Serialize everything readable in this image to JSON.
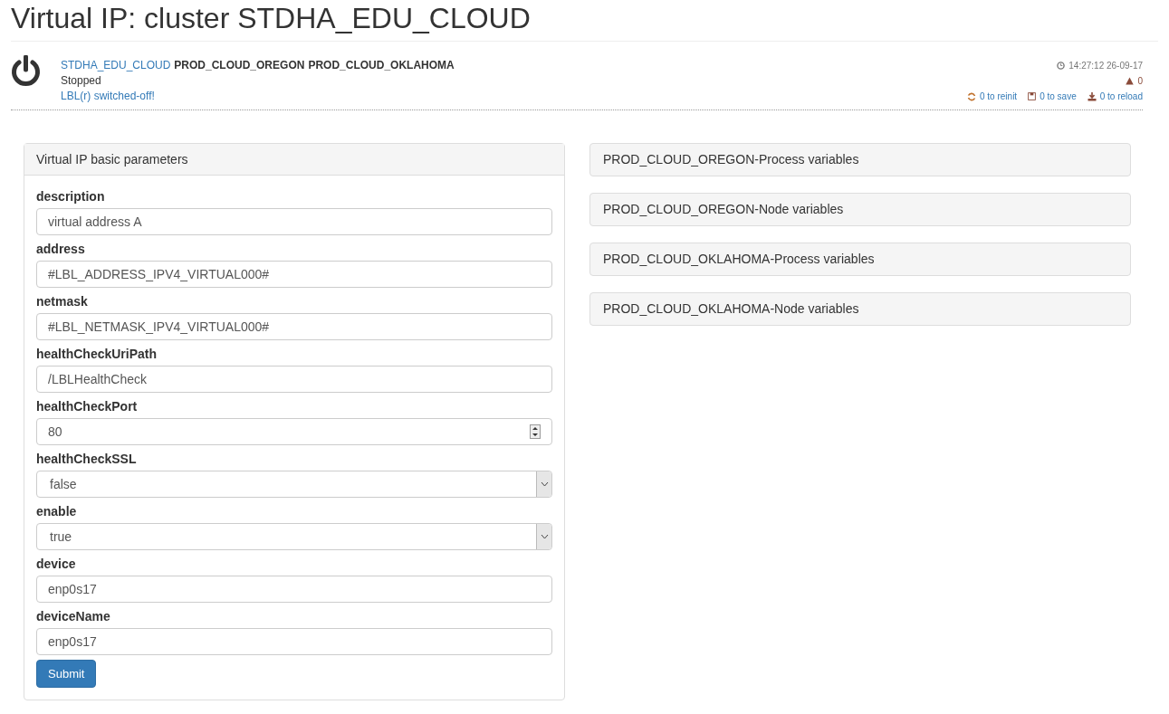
{
  "title": "Virtual IP: cluster STDHA_EDU_CLOUD",
  "status": {
    "cluster": "STDHA_EDU_CLOUD",
    "nodes": [
      "PROD_CLOUD_OREGON",
      "PROD_CLOUD_OKLAHOMA"
    ],
    "state": "Stopped",
    "message": "LBL(r) switched-off!",
    "time": "14:27:12 26-09-17",
    "warnings": "0",
    "reinit": "0 to reinit",
    "save": "0 to save",
    "reload": "0 to reload"
  },
  "form": {
    "heading": "Virtual IP basic parameters",
    "submit": "Submit",
    "fields": [
      {
        "label": "description",
        "kind": "text",
        "value": "virtual address A"
      },
      {
        "label": "address",
        "kind": "text",
        "value": "#LBL_ADDRESS_IPV4_VIRTUAL000#"
      },
      {
        "label": "netmask",
        "kind": "text",
        "value": "#LBL_NETMASK_IPV4_VIRTUAL000#"
      },
      {
        "label": "healthCheckUriPath",
        "kind": "text",
        "value": "/LBLHealthCheck"
      },
      {
        "label": "healthCheckPort",
        "kind": "number",
        "value": "80"
      },
      {
        "label": "healthCheckSSL",
        "kind": "select",
        "value": "false"
      },
      {
        "label": "enable",
        "kind": "select",
        "value": "true"
      },
      {
        "label": "device",
        "kind": "text",
        "value": "enp0s17"
      },
      {
        "label": "deviceName",
        "kind": "text",
        "value": "enp0s17"
      }
    ]
  },
  "panels": [
    "PROD_CLOUD_OREGON-Process variables",
    "PROD_CLOUD_OREGON-Node variables",
    "PROD_CLOUD_OKLAHOMA-Process variables",
    "PROD_CLOUD_OKLAHOMA-Node variables"
  ]
}
